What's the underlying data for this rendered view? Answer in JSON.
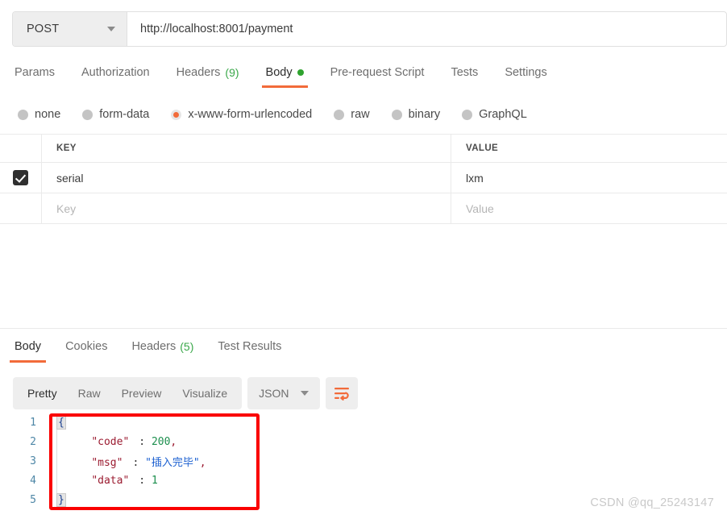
{
  "request": {
    "method": "POST",
    "url": "http://localhost:8001/payment",
    "tabs": [
      {
        "label": "Params",
        "count": "",
        "active": false,
        "dot": false
      },
      {
        "label": "Authorization",
        "count": "",
        "active": false,
        "dot": false
      },
      {
        "label": "Headers",
        "count": "(9)",
        "active": false,
        "dot": false
      },
      {
        "label": "Body",
        "count": "",
        "active": true,
        "dot": true
      },
      {
        "label": "Pre-request Script",
        "count": "",
        "active": false,
        "dot": false
      },
      {
        "label": "Tests",
        "count": "",
        "active": false,
        "dot": false
      },
      {
        "label": "Settings",
        "count": "",
        "active": false,
        "dot": false
      }
    ],
    "body_types": [
      {
        "label": "none",
        "selected": false
      },
      {
        "label": "form-data",
        "selected": false
      },
      {
        "label": "x-www-form-urlencoded",
        "selected": true
      },
      {
        "label": "raw",
        "selected": false
      },
      {
        "label": "binary",
        "selected": false
      },
      {
        "label": "GraphQL",
        "selected": false
      }
    ],
    "table": {
      "columns": {
        "key": "KEY",
        "value": "VALUE"
      },
      "rows": [
        {
          "checked": true,
          "key": "serial",
          "value": "lxm",
          "placeholder": false
        }
      ],
      "placeholder_row": {
        "key": "Key",
        "value": "Value"
      }
    }
  },
  "response": {
    "tabs": [
      {
        "label": "Body",
        "count": "",
        "active": true
      },
      {
        "label": "Cookies",
        "count": "",
        "active": false
      },
      {
        "label": "Headers",
        "count": "(5)",
        "active": false
      },
      {
        "label": "Test Results",
        "count": "",
        "active": false
      }
    ],
    "view_modes": [
      {
        "label": "Pretty",
        "active": true
      },
      {
        "label": "Raw",
        "active": false
      },
      {
        "label": "Preview",
        "active": false
      },
      {
        "label": "Visualize",
        "active": false
      }
    ],
    "format": "JSON",
    "wrap_icon": "wrap-text-icon",
    "body_lines": [
      {
        "n": "1",
        "segments": [
          {
            "t": "{",
            "c": "brace"
          }
        ]
      },
      {
        "n": "2",
        "segments": [
          {
            "t": "    ",
            "c": "code"
          },
          {
            "t": "\"code\"",
            "c": "k"
          },
          {
            "t": ": ",
            "c": "code"
          },
          {
            "t": "200",
            "c": "num"
          },
          {
            "t": ",",
            "c": "punct"
          }
        ]
      },
      {
        "n": "3",
        "segments": [
          {
            "t": "    ",
            "c": "code"
          },
          {
            "t": "\"msg\"",
            "c": "k"
          },
          {
            "t": ": ",
            "c": "code"
          },
          {
            "t": "\"插入完毕\"",
            "c": "str"
          },
          {
            "t": ",",
            "c": "punct"
          }
        ]
      },
      {
        "n": "4",
        "segments": [
          {
            "t": "    ",
            "c": "code"
          },
          {
            "t": "\"data\"",
            "c": "k"
          },
          {
            "t": ": ",
            "c": "code"
          },
          {
            "t": "1",
            "c": "num"
          }
        ]
      },
      {
        "n": "5",
        "segments": [
          {
            "t": "}",
            "c": "brace"
          }
        ]
      }
    ]
  },
  "watermark": "CSDN @qq_25243147",
  "colors": {
    "accent_orange": "#f26b3a",
    "green": "#2fa32f",
    "annotation_red": "#fa0000"
  }
}
